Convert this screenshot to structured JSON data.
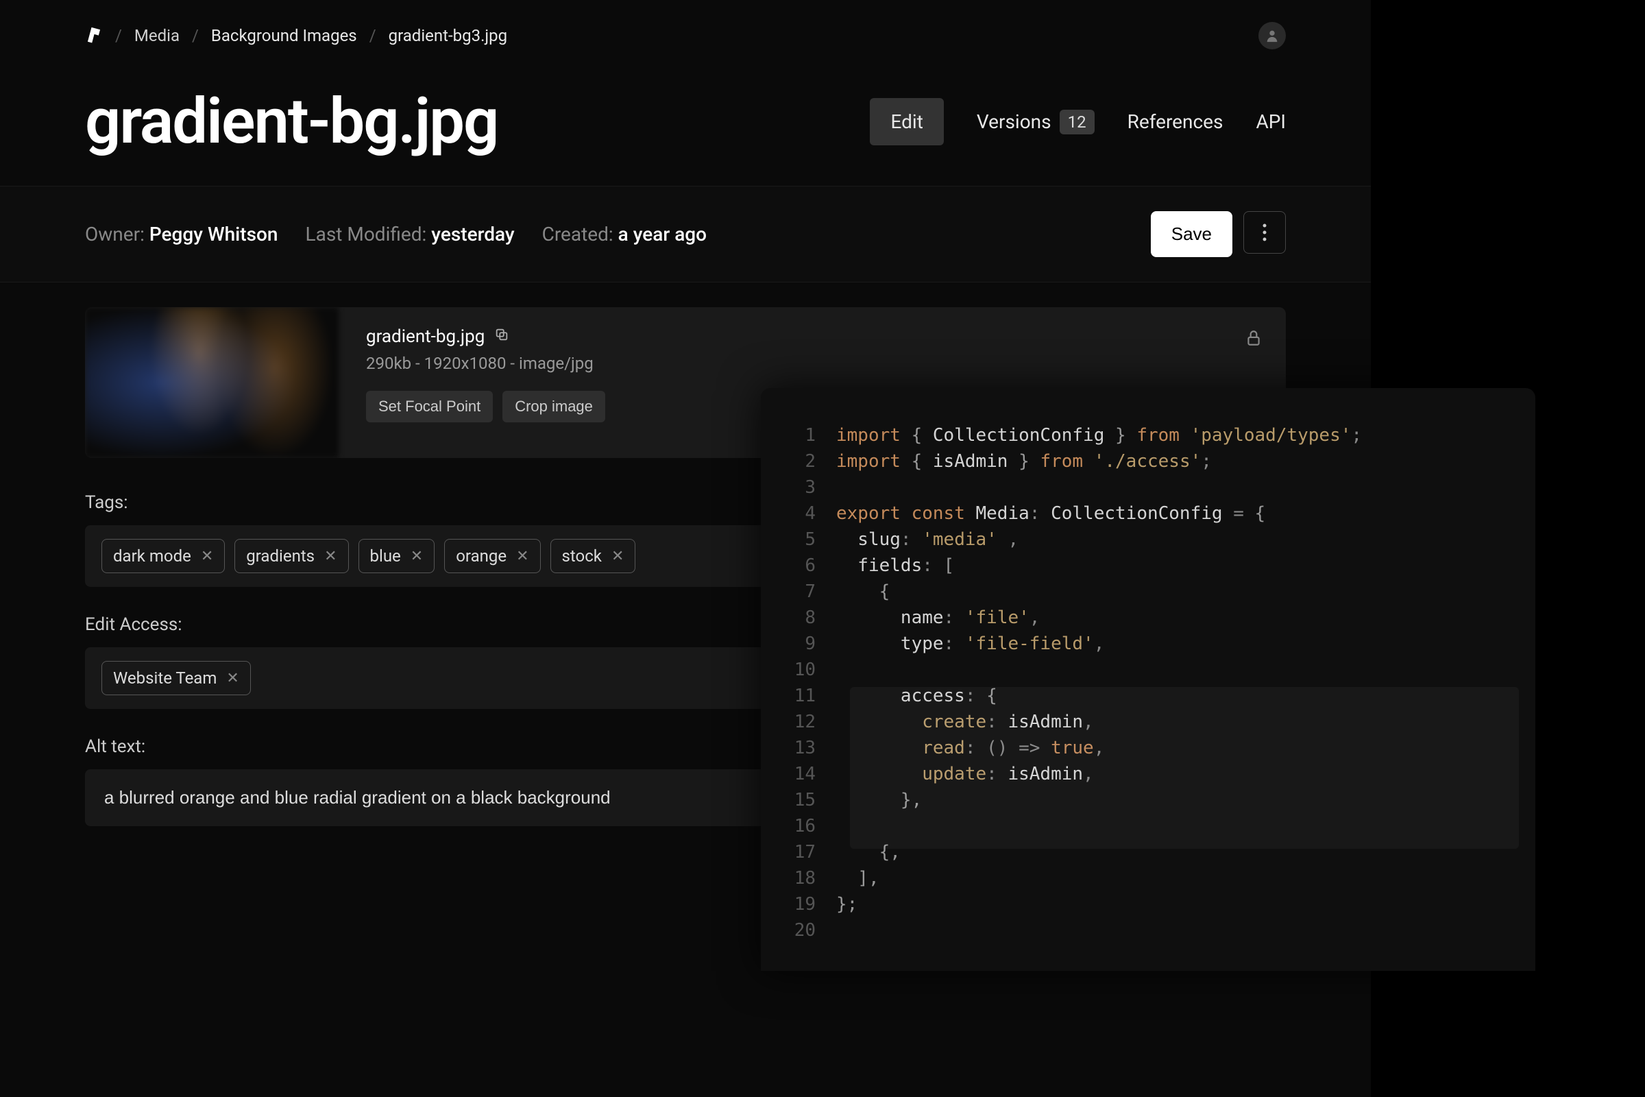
{
  "breadcrumb": {
    "items": [
      "Media",
      "Background Images",
      "gradient-bg3.jpg"
    ]
  },
  "page": {
    "title": "gradient-bg.jpg"
  },
  "tabs": {
    "edit": "Edit",
    "versions": "Versions",
    "versions_count": "12",
    "references": "References",
    "api": "API"
  },
  "meta": {
    "owner_label": "Owner:",
    "owner": "Peggy Whitson",
    "modified_label": "Last Modified:",
    "modified": "yesterday",
    "created_label": "Created:",
    "created": "a year ago"
  },
  "actions": {
    "save": "Save"
  },
  "media": {
    "filename": "gradient-bg.jpg",
    "details": "290kb - 1920x1080 - image/jpg",
    "set_focal": "Set Focal Point",
    "crop": "Crop image"
  },
  "fields": {
    "tags_label": "Tags:",
    "tags": [
      "dark mode",
      "gradients",
      "blue",
      "orange",
      "stock"
    ],
    "access_label": "Edit Access:",
    "access": [
      "Website Team"
    ],
    "alt_label": "Alt text:",
    "alt_value": "a blurred orange and blue radial gradient on a black background"
  },
  "code": {
    "lines": [
      [
        {
          "t": "import ",
          "c": "kw"
        },
        {
          "t": "{ ",
          "c": "brace"
        },
        {
          "t": "CollectionConfig",
          "c": "type"
        },
        {
          "t": " } ",
          "c": "brace"
        },
        {
          "t": "from ",
          "c": "kw"
        },
        {
          "t": "'payload/types'",
          "c": "str"
        },
        {
          "t": ";",
          "c": "punct"
        }
      ],
      [
        {
          "t": "import ",
          "c": "kw"
        },
        {
          "t": "{ ",
          "c": "brace"
        },
        {
          "t": "isAdmin",
          "c": "ident"
        },
        {
          "t": " } ",
          "c": "brace"
        },
        {
          "t": "from ",
          "c": "kw"
        },
        {
          "t": "'./access'",
          "c": "str"
        },
        {
          "t": ";",
          "c": "punct"
        }
      ],
      [],
      [
        {
          "t": "export ",
          "c": "kw"
        },
        {
          "t": "const ",
          "c": "kw"
        },
        {
          "t": "Media",
          "c": "type"
        },
        {
          "t": ": ",
          "c": "punct"
        },
        {
          "t": "CollectionConfig",
          "c": "type"
        },
        {
          "t": " = ",
          "c": "punct"
        },
        {
          "t": "{",
          "c": "brace"
        }
      ],
      [
        {
          "t": "  slug",
          "c": "ident"
        },
        {
          "t": ": ",
          "c": "punct"
        },
        {
          "t": "'media'",
          "c": "str"
        },
        {
          "t": " ,",
          "c": "punct"
        }
      ],
      [
        {
          "t": "  fields",
          "c": "ident"
        },
        {
          "t": ": ",
          "c": "punct"
        },
        {
          "t": "[",
          "c": "brace"
        }
      ],
      [
        {
          "t": "    {",
          "c": "brace"
        }
      ],
      [
        {
          "t": "      name",
          "c": "ident"
        },
        {
          "t": ": ",
          "c": "punct"
        },
        {
          "t": "'file'",
          "c": "str"
        },
        {
          "t": ",",
          "c": "punct"
        }
      ],
      [
        {
          "t": "      type",
          "c": "ident"
        },
        {
          "t": ": ",
          "c": "punct"
        },
        {
          "t": "'file-field'",
          "c": "str"
        },
        {
          "t": ",",
          "c": "punct"
        }
      ],
      [],
      [
        {
          "t": "      access",
          "c": "ident"
        },
        {
          "t": ": ",
          "c": "punct"
        },
        {
          "t": "{",
          "c": "brace"
        }
      ],
      [
        {
          "t": "        create",
          "c": "fn"
        },
        {
          "t": ": ",
          "c": "punct"
        },
        {
          "t": "isAdmin",
          "c": "ident"
        },
        {
          "t": ",",
          "c": "punct"
        }
      ],
      [
        {
          "t": "        read",
          "c": "fn"
        },
        {
          "t": ": ",
          "c": "punct"
        },
        {
          "t": "() ",
          "c": "punct"
        },
        {
          "t": "=> ",
          "c": "punct"
        },
        {
          "t": "true",
          "c": "kw"
        },
        {
          "t": ",",
          "c": "punct"
        }
      ],
      [
        {
          "t": "        update",
          "c": "fn"
        },
        {
          "t": ": ",
          "c": "punct"
        },
        {
          "t": "isAdmin",
          "c": "ident"
        },
        {
          "t": ",",
          "c": "punct"
        }
      ],
      [
        {
          "t": "      },",
          "c": "brace"
        }
      ],
      [],
      [
        {
          "t": "    {,",
          "c": "brace"
        }
      ],
      [
        {
          "t": "  ],",
          "c": "brace"
        }
      ],
      [
        {
          "t": "};",
          "c": "brace"
        }
      ],
      []
    ]
  }
}
